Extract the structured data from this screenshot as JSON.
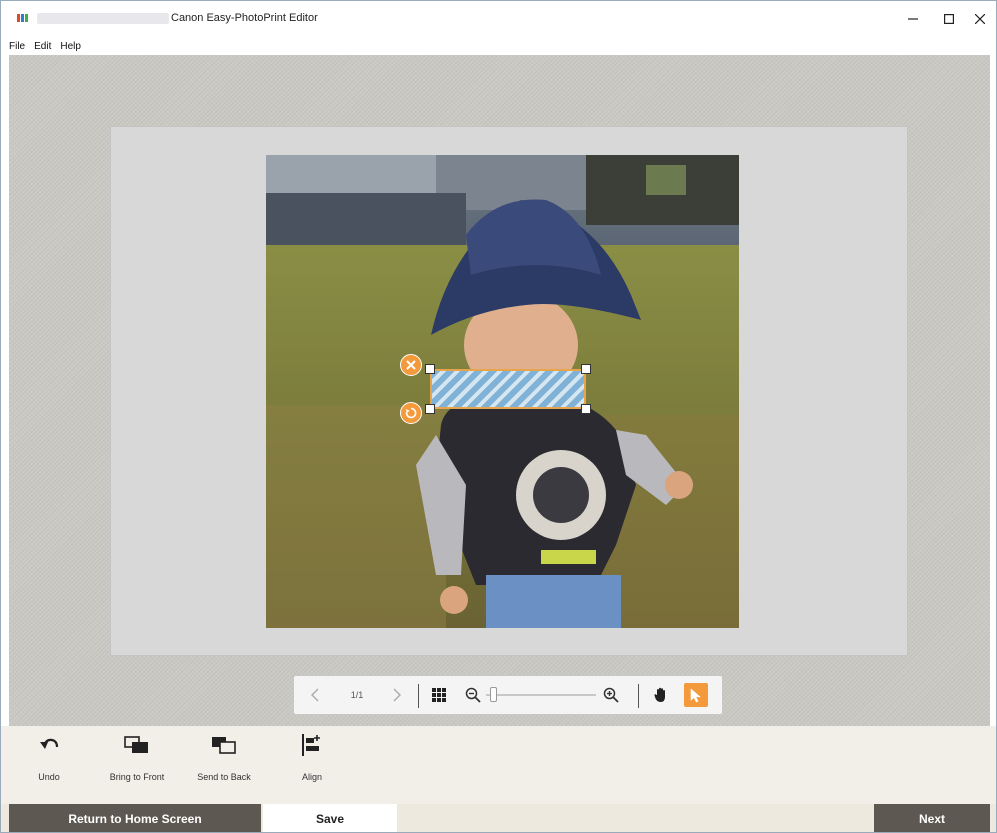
{
  "window": {
    "title": "Canon Easy-PhotoPrint Editor",
    "controls": {
      "minimize": "minimize",
      "maximize": "maximize",
      "close": "close"
    }
  },
  "menu": [
    "File",
    "Edit",
    "Help"
  ],
  "canvas": {
    "photo_description_icon": "photo",
    "selection": {
      "delete_icon": "close-icon",
      "rotate_icon": "rotate-icon"
    }
  },
  "zoombar": {
    "page_indicator": "1/1",
    "zoom_level": 0.05,
    "active_tool": "pointer"
  },
  "tools": [
    {
      "id": "undo",
      "label": "Undo",
      "icon": "undo-icon"
    },
    {
      "id": "bring-to-front",
      "label": "Bring to Front",
      "icon": "bring-to-front-icon"
    },
    {
      "id": "send-to-back",
      "label": "Send to Back",
      "icon": "send-to-back-icon"
    },
    {
      "id": "align",
      "label": "Align",
      "icon": "align-icon"
    }
  ],
  "footer": {
    "home_label": "Return to Home Screen",
    "save_label": "Save",
    "next_label": "Next"
  },
  "colors": {
    "accent": "#f39a3c",
    "footer_button": "#5e5852",
    "workspace": "#cbc9c3"
  }
}
